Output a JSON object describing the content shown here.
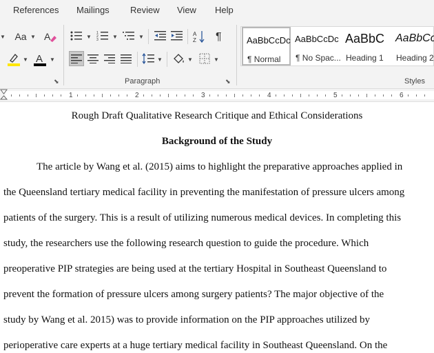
{
  "menu": [
    "References",
    "Mailings",
    "Review",
    "View",
    "Help"
  ],
  "ribbon": {
    "font_size_label": "Aa",
    "paragraph_label": "Paragraph",
    "styles_label": "Styles",
    "font_color": "#000000",
    "highlight_color": "#ffe600"
  },
  "styles": [
    {
      "sample": "AaBbCcDc",
      "name": "¶ Normal"
    },
    {
      "sample": "AaBbCcDc",
      "name": "¶ No Spac..."
    },
    {
      "sample": "AaBbC",
      "name": "Heading 1"
    },
    {
      "sample": "AaBbCc",
      "name": "Heading 2"
    }
  ],
  "ruler": {
    "numbers": [
      "1",
      "2",
      "3",
      "4",
      "5",
      "6"
    ]
  },
  "document": {
    "title": "Rough Draft Qualitative Research Critique and Ethical Considerations",
    "heading": "Background of the Study",
    "lines": [
      "The article by Wang et al. (2015) aims to highlight the preparative approaches applied in",
      "the Queensland tertiary medical facility in preventing the manifestation of pressure ulcers among",
      "patients of the surgery. This is a result of utilizing numerous medical devices. In completing this",
      "study, the researchers use the following research question to guide the procedure. Which",
      "preoperative PIP strategies are being used at the tertiary Hospital in Southeast Queensland to",
      "prevent the formation of pressure ulcers among surgery patients? The major objective of the",
      "study by Wang et al. 2015) was to provide information on the PIP approaches utilized by",
      "perioperative care experts at a huge tertiary medical facility in Southeast Queensland. On the"
    ]
  }
}
